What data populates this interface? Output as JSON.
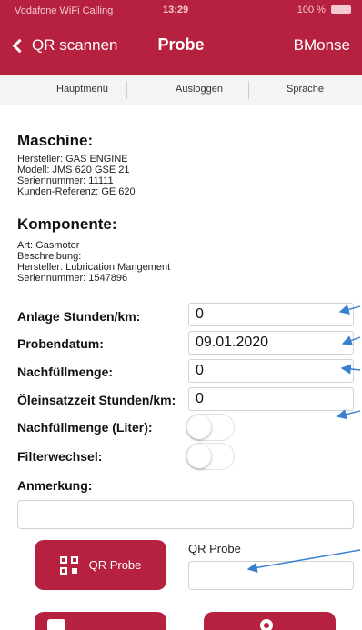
{
  "status_bar": {
    "carrier": "Vodafone WiFi Calling",
    "time": "13:29",
    "battery": "100 %"
  },
  "nav": {
    "back_label": "QR scannen",
    "title": "Probe",
    "right_label": "BMonse"
  },
  "toolbar": {
    "items": [
      "Hauptmenü",
      "Ausloggen",
      "Sprache"
    ]
  },
  "machine": {
    "heading": "Maschine:",
    "lines": [
      "Hersteller: GAS ENGINE",
      "Modell: JMS 620 GSE 21",
      "Seriennummer: 11111",
      "Kunden-Referenz: GE 620"
    ]
  },
  "component": {
    "heading": "Komponente:",
    "lines": [
      "Art: Gasmotor",
      "Beschreibung:",
      "Hersteller: Lubrication Mangement",
      "Seriennummer: 1547896"
    ]
  },
  "fields": [
    {
      "label": "Anlage Stunden/km:",
      "value": "0"
    },
    {
      "label": "Probendatum:",
      "value": "09.01.2020"
    },
    {
      "label": "Nachfüllmenge:",
      "value": "0"
    },
    {
      "label": "Öleinsatzzeit Stunden/km:",
      "value": "0"
    }
  ],
  "toggles": [
    {
      "label": "Nachfüllmenge (Liter):",
      "on": false
    },
    {
      "label": "Filterwechsel:",
      "on": false
    }
  ],
  "note": {
    "label": "Anmerkung:"
  },
  "qr": {
    "button_label": "QR Probe",
    "field_label": "QR Probe"
  },
  "colors": {
    "brand": "#b5213f",
    "annotation_arrow": "#3a7fd0"
  }
}
